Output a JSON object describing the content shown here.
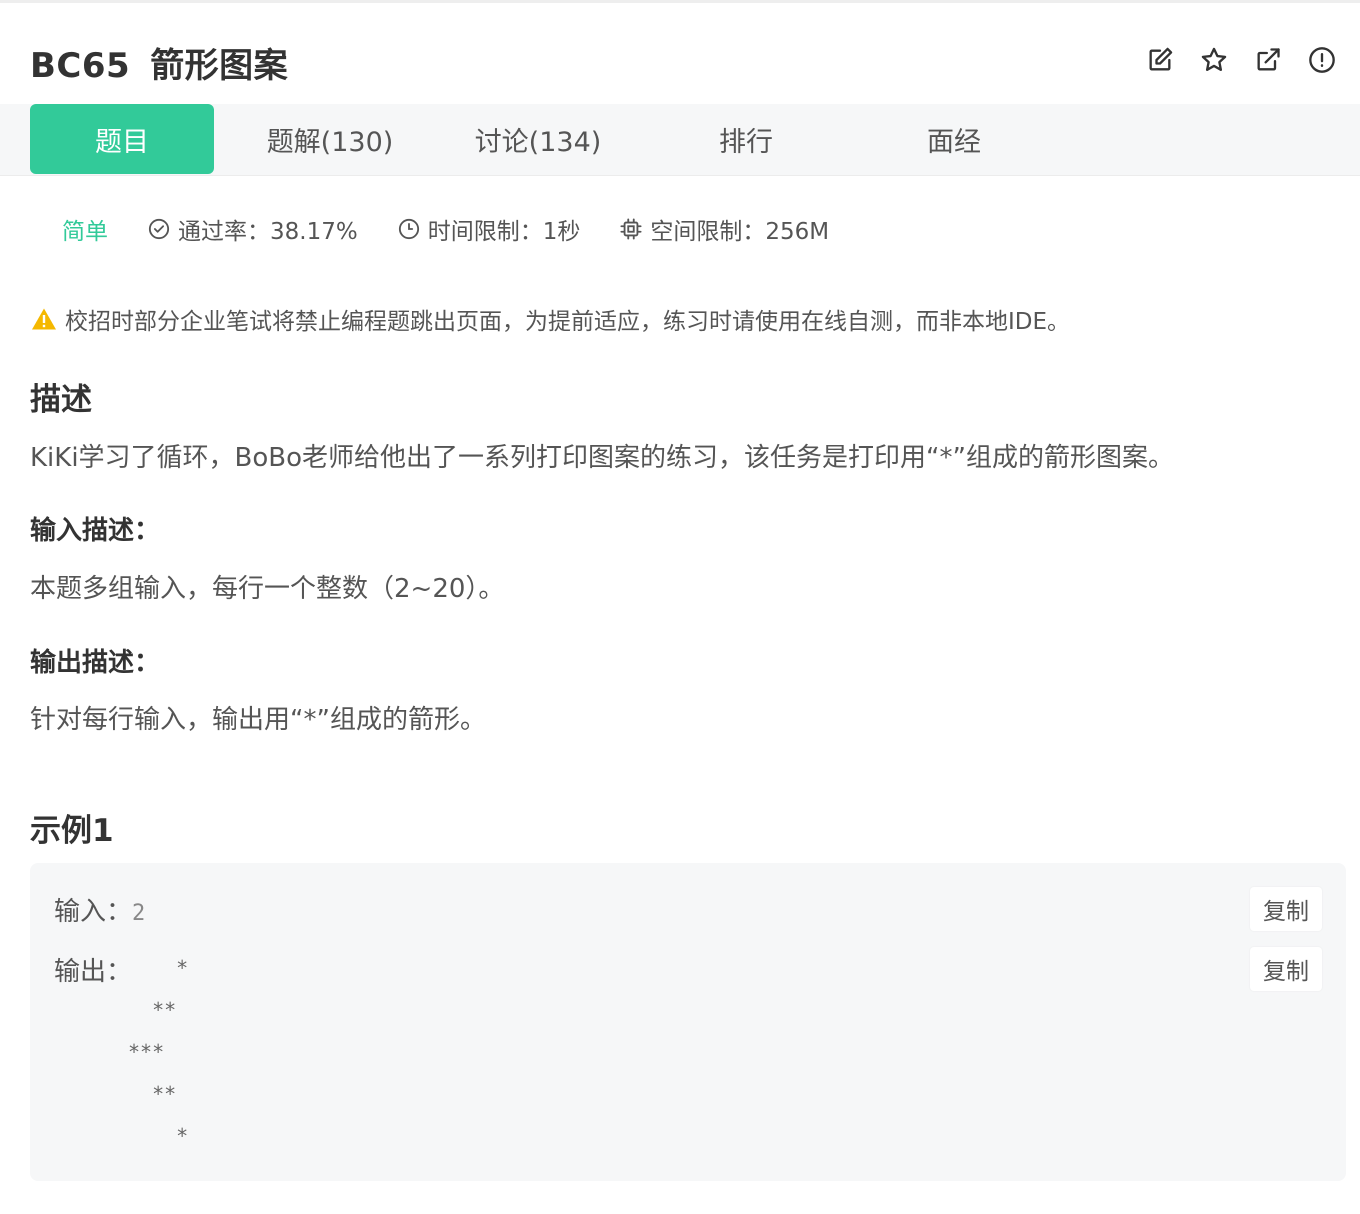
{
  "header": {
    "code": "BC65",
    "title": "箭形图案",
    "icons": [
      "edit-icon",
      "star-icon",
      "external-link-icon",
      "alert-circle-icon"
    ]
  },
  "tabs": [
    {
      "label": "题目",
      "active": true
    },
    {
      "label": "题解(130)",
      "active": false
    },
    {
      "label": "讨论(134)",
      "active": false
    },
    {
      "label": "排行",
      "active": false
    },
    {
      "label": "面经",
      "active": false
    }
  ],
  "meta": {
    "difficulty": "简单",
    "pass_rate": "通过率：38.17%",
    "time_limit": "时间限制：1秒",
    "memory_limit": "空间限制：256M"
  },
  "warning": "校招时部分企业笔试将禁止编程题跳出页面，为提前适应，练习时请使用在线自测，而非本地IDE。",
  "description": {
    "heading": "描述",
    "text": "KiKi学习了循环，BoBo老师给他出了一系列打印图案的练习，该任务是打印用“*”组成的箭形图案。"
  },
  "input_desc": {
    "heading": "输入描述：",
    "text": "本题多组输入，每行一个整数（2~20）。"
  },
  "output_desc": {
    "heading": "输出描述：",
    "text": "针对每行输入，输出用“*”组成的箭形。"
  },
  "example": {
    "heading": "示例1",
    "input_label": "输入：",
    "input_value": "2",
    "output_label": "输出：",
    "output_value": "    *\n  **\n***\n  **\n    *",
    "copy_label": "复制"
  },
  "colors": {
    "accent": "#32ca99",
    "warning": "#f5b800",
    "tab_bg": "#f6f7f8",
    "example_bg": "#f6f7f8"
  }
}
